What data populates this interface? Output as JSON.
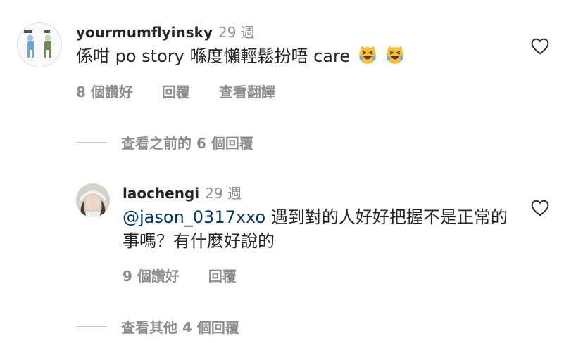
{
  "comments": [
    {
      "username": "yourmumflyinsky",
      "time": "29 週",
      "text": "係咁 po story 喺度懶輕鬆扮唔 care",
      "emoji": "crying-laughing-cat-emoji",
      "likes": "8 個讚好",
      "reply_label": "回覆",
      "translate_label": "查看翻譯"
    },
    {
      "username": "laochengi",
      "time": "29 週",
      "mention": "@jason_0317xxo",
      "text": "遇到對的人好好把握不是正常的事嗎？有什麼好說的",
      "likes": "9 個讚好",
      "reply_label": "回覆"
    }
  ],
  "view_previous_replies": "查看之前的 6 個回覆",
  "view_other_replies": "查看其他 4 個回覆",
  "colors": {
    "text": "#262626",
    "secondary": "#8e8e8e",
    "mention": "#00376b"
  },
  "icons": {
    "like": "heart-outline-icon"
  }
}
